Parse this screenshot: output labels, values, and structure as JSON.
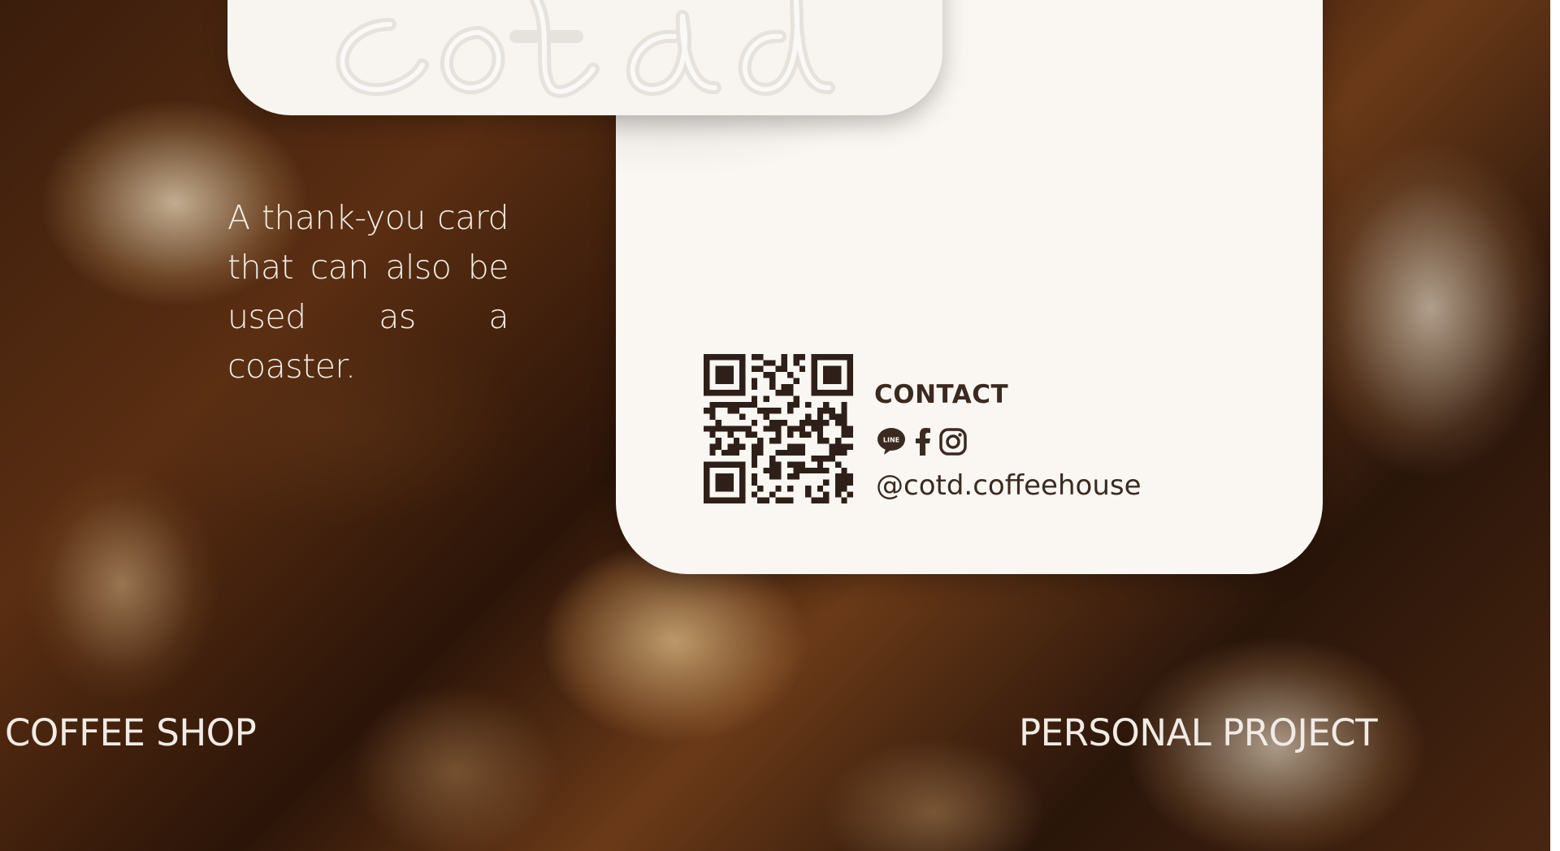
{
  "hero": {
    "logo_text": "cotd"
  },
  "tagline": "A thank-you card that can also be used as a coaster.",
  "card": {
    "contact_title": "CONTACT",
    "social_icons": [
      "line-icon",
      "facebook-icon",
      "instagram-icon"
    ],
    "handle": "@cotd.coffeehouse"
  },
  "labels": {
    "left": "COFFEE SHOP",
    "right": "PERSONAL PROJECT"
  },
  "colors": {
    "card_bg": "#faf6f2",
    "text_dark": "#3a2a20",
    "text_light": "#f1ebe4"
  }
}
